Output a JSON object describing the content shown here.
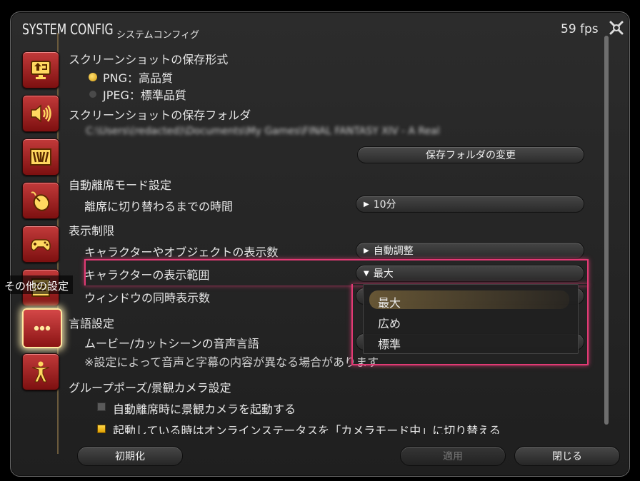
{
  "window": {
    "title_en": "SYSTEM CONFIG",
    "title_jp": "システムコンフィグ",
    "fps": "59 fps"
  },
  "nav": {
    "tooltip": "その他の設定",
    "items": [
      {
        "icon": "display-settings-icon"
      },
      {
        "icon": "sound-icon"
      },
      {
        "icon": "theme-icon"
      },
      {
        "icon": "mouse-icon"
      },
      {
        "icon": "gamepad-icon"
      },
      {
        "icon": "log-window-icon"
      },
      {
        "icon": "other-settings-icon",
        "active": true
      },
      {
        "icon": "accessibility-icon"
      }
    ]
  },
  "screenshot": {
    "format_heading": "スクリーンショットの保存形式",
    "options": [
      "PNG：高品質",
      "JPEG：標準品質"
    ],
    "selected_option": "PNG：高品質",
    "folder_heading": "スクリーンショットの保存フォルダ",
    "folder_path": "C:\\Users\\(redacted)\\Documents\\My Games\\FINAL FANTASY XIV - A Real",
    "change_folder_button": "保存フォルダの変更"
  },
  "afk": {
    "heading": "自動離席モード設定",
    "time_label": "離席に切り替わるまでの時間",
    "time_value": "10分"
  },
  "display_limits": {
    "heading": "表示制限",
    "object_count_label": "キャラクターやオブジェクトの表示数",
    "object_count_value": "自動調整",
    "character_range_label": "キャラクターの表示範囲",
    "character_range_value": "最大",
    "window_count_label": "ウィンドウの同時表示数"
  },
  "range_dropdown_options": [
    "最大",
    "広め",
    "標準"
  ],
  "language": {
    "heading": "言語設定",
    "movie_label": "ムービー/カットシーンの音声言語",
    "note": "※設定によって音声と字幕の内容が異なる場合があります"
  },
  "group_pose": {
    "heading": "グループポーズ/景観カメラ設定",
    "checkbox1": "自動離席時に景観カメラを起動する",
    "checkbox1_checked": false,
    "checkbox2": "起動している時はオンラインステータスを「カメラモード中」に切り替える",
    "checkbox2_checked": true
  },
  "footer": {
    "reset": "初期化",
    "apply": "適用",
    "close": "閉じる"
  },
  "colors": {
    "highlight": "#e23a74",
    "nav_red": "#b32828",
    "accent_gold": "#f0c030"
  }
}
